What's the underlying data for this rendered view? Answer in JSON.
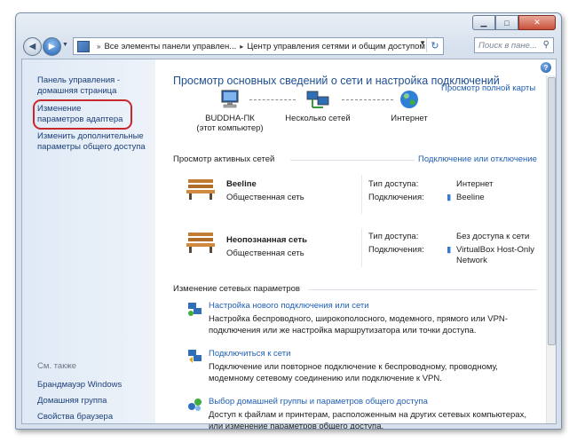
{
  "address_bar": {
    "crumbs": [
      "Все элементы панели управлен...",
      "Центр управления сетями и общим доступом"
    ],
    "search_placeholder": "Поиск в пане..."
  },
  "sidebar": {
    "home": "Панель управления - домашняя страница",
    "adapter": "Изменение параметров адаптера",
    "sharing": "Изменить дополнительные параметры общего доступа",
    "see_also_label": "См. также",
    "see_also": [
      "Брандмауэр Windows",
      "Домашняя группа",
      "Свойства браузера"
    ]
  },
  "main": {
    "title": "Просмотр основных сведений о сети и настройка подключений",
    "full_map_link": "Просмотр полной карты",
    "map": [
      {
        "label": "BUDDHA-ПК",
        "sub": "(этот компьютер)"
      },
      {
        "label": "Несколько сетей",
        "sub": ""
      },
      {
        "label": "Интернет",
        "sub": ""
      }
    ],
    "active_header": "Просмотр активных сетей",
    "connect_link": "Подключение или отключение",
    "networks": [
      {
        "name": "Beeline",
        "type": "Общественная сеть",
        "type_is_link": true,
        "access_label": "Тип доступа:",
        "access": "Интернет",
        "conn_label": "Подключения:",
        "conn": "Beeline",
        "conn2": ""
      },
      {
        "name": "Неопознанная сеть",
        "type": "Общественная сеть",
        "type_is_link": false,
        "access_label": "Тип доступа:",
        "access": "Без доступа к сети",
        "conn_label": "Подключения:",
        "conn": "VirtualBox Host-Only",
        "conn2": "Network"
      }
    ],
    "change_header": "Изменение сетевых параметров",
    "tasks": [
      {
        "title": "Настройка нового подключения или сети",
        "desc": "Настройка беспроводного, широкополосного, модемного, прямого или VPN-подключения или же настройка маршрутизатора или точки доступа."
      },
      {
        "title": "Подключиться к сети",
        "desc": "Подключение или повторное подключение к беспроводному, проводному, модемному сетевому соединению или подключение к VPN."
      },
      {
        "title": "Выбор домашней группы и параметров общего доступа",
        "desc": "Доступ к файлам и принтерам, расположенным на других сетевых компьютерах, или изменение параметров общего доступа."
      }
    ]
  }
}
